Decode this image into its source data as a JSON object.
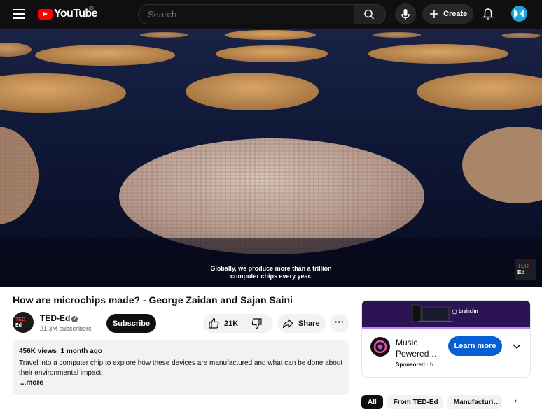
{
  "header": {
    "logo_text": "YouTube",
    "country_code": "ID",
    "search_placeholder": "Search",
    "create_label": "Create"
  },
  "player": {
    "caption": "Globally, we produce more than a trillion computer chips every year.",
    "watermark_ted": "TED",
    "watermark_ed": "Ed"
  },
  "video": {
    "title": "How are microchips made? - George Zaidan and Sajan Saini",
    "channel_name": "TED-Ed",
    "channel_avatar_ted": "TED",
    "channel_avatar_ed": "Ed",
    "subscribers": "21.3M subscribers",
    "subscribe_label": "Subscribe",
    "likes": "21K",
    "share_label": "Share",
    "more_actions": "···"
  },
  "description": {
    "views": "456K views",
    "age": "1 month ago",
    "text": "Travel into a computer chip to explore how these devices are manufactured and what can be done about their environmental impact.",
    "more_label": "...more"
  },
  "ad": {
    "banner_brand": "brain.fm",
    "title": "Music Powered …",
    "sponsored": "Sponsored",
    "domain": "b…",
    "cta": "Learn more"
  },
  "chips": [
    "All",
    "From TED-Ed",
    "Manufacturi…"
  ],
  "colors": {
    "youtube_red": "#ff0000",
    "ted_red": "#e62b1e",
    "cta_blue": "#065fd4",
    "ad_banner": "#2c1454"
  }
}
